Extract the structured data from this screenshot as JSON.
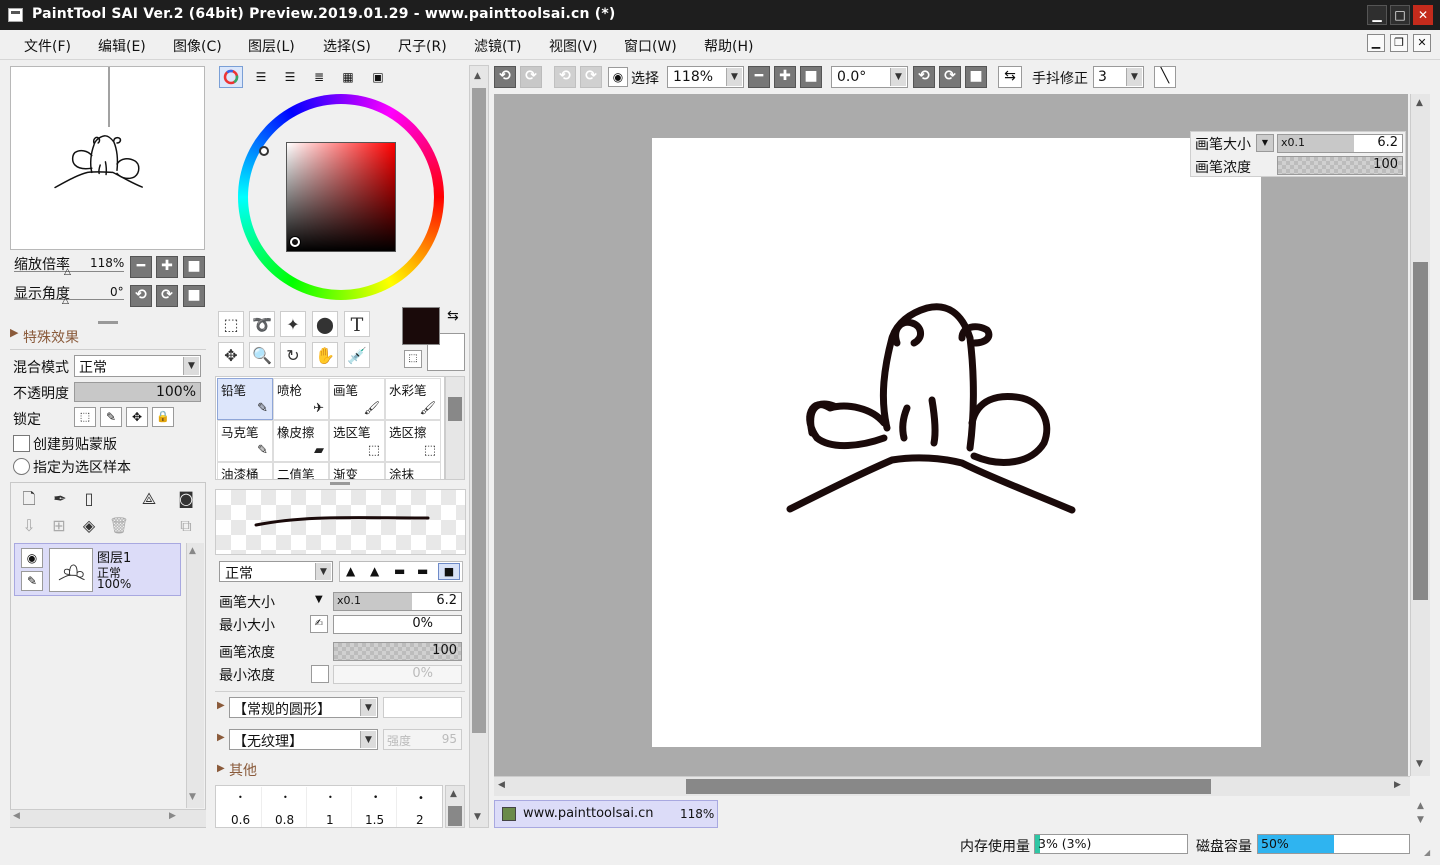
{
  "window": {
    "title": "PaintTool SAI Ver.2 (64bit) Preview.2019.01.29 - www.painttoolsai.cn (*)",
    "minimize": "▁",
    "maximize": "□",
    "close": "✕",
    "mdi_min": "▁",
    "mdi_restore": "❐",
    "mdi_close": "✕"
  },
  "menu": [
    "文件(F)",
    "编辑(E)",
    "图像(C)",
    "图层(L)",
    "选择(S)",
    "尺子(R)",
    "滤镜(T)",
    "视图(V)",
    "窗口(W)",
    "帮助(H)"
  ],
  "navigator": {
    "zoom_label": "缩放倍率",
    "zoom_value": "118%",
    "angle_label": "显示角度",
    "angle_value": "0°",
    "btn_minus": "━",
    "btn_plus": "✚",
    "btn_reset": "■",
    "btn_rot_l": "⟲",
    "btn_rot_r": "⟳"
  },
  "layer_props": {
    "effects": "特殊效果",
    "blend_label": "混合模式",
    "blend_value": "正常",
    "opacity_label": "不透明度",
    "opacity_value": "100%",
    "lock_label": "锁定",
    "clip_label": "创建剪贴蒙版",
    "select_source_label": "指定为选区样本"
  },
  "layers": [
    {
      "name": "图层1",
      "mode": "正常",
      "opacity": "100%"
    }
  ],
  "color": {
    "primary": "#1a0a0a",
    "secondary": "#ffffff",
    "ring_marker_hue": "#ff2a2a"
  },
  "tools": [
    {
      "name": "铅笔",
      "icon": "✎"
    },
    {
      "name": "喷枪",
      "icon": "✈"
    },
    {
      "name": "画笔",
      "icon": "🖌"
    },
    {
      "name": "水彩笔",
      "icon": "🖌"
    },
    {
      "name": "马克笔",
      "icon": "✎"
    },
    {
      "name": "橡皮擦",
      "icon": "▰"
    },
    {
      "name": "选区笔",
      "icon": "⬚"
    },
    {
      "name": "选区擦",
      "icon": "⬚"
    },
    {
      "name": "油漆桶",
      "icon": ""
    },
    {
      "name": "二值笔",
      "icon": ""
    },
    {
      "name": "渐变",
      "icon": ""
    },
    {
      "name": "涂抹",
      "icon": ""
    }
  ],
  "brush": {
    "mode": "正常",
    "size_label": "画笔大小",
    "size_mult": "x0.1",
    "size_value": "6.2",
    "min_size_label": "最小大小",
    "min_size_value": "0%",
    "density_label": "画笔浓度",
    "density_value": "100",
    "min_density_label": "最小浓度",
    "min_density_value": "0%",
    "shape": "【常规的圆形】",
    "texture": "【无纹理】",
    "texture_strength_label": "强度",
    "texture_strength_value": "95",
    "other": "其他",
    "presets": [
      "0.6",
      "0.8",
      "1",
      "1.5",
      "2"
    ]
  },
  "toolbar": {
    "select_label": "选择",
    "zoom": "118%",
    "angle": "0.0°",
    "stabilizer_label": "手抖修正",
    "stabilizer_value": "3"
  },
  "canvas_hud": {
    "size_label": "画笔大小",
    "size_mult": "x0.1",
    "size_value": "6.2",
    "density_label": "画笔浓度",
    "density_value": "100"
  },
  "document_tab": {
    "name": "www.painttoolsai.cn",
    "zoom": "118%"
  },
  "status": {
    "memory_label": "内存使用量",
    "memory_value": "3% (3%)",
    "memory_fraction": 0.03,
    "disk_label": "磁盘容量",
    "disk_value": "50%",
    "disk_fraction": 0.5
  }
}
